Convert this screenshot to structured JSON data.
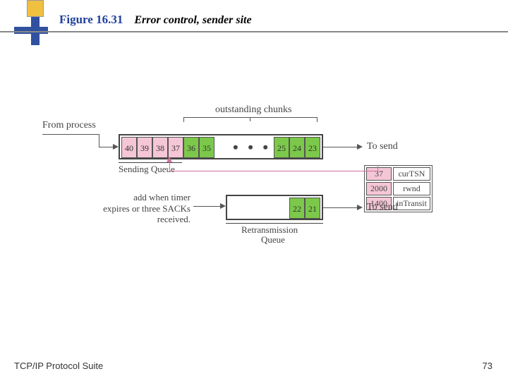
{
  "figure": {
    "number": "Figure 16.31",
    "title": "Error control, sender site"
  },
  "labels": {
    "from_process": "From process",
    "outstanding": "outstanding chunks",
    "to_send_1": "To send",
    "to_send_2": "To send",
    "sending_queue": "Sending Queue",
    "retrans_queue": "Retransmission Queue",
    "add_note_l1": "add when timer",
    "add_note_l2": "expires or three SACKs",
    "add_note_l3": "received.",
    "dots": "• • •"
  },
  "sending_queue": {
    "left": [
      "40",
      "39",
      "38",
      "37",
      "36",
      "35"
    ],
    "right": [
      "25",
      "24",
      "23"
    ]
  },
  "retrans_queue": [
    "22",
    "21"
  ],
  "state": {
    "curTSN": {
      "val": "37",
      "label": "curTSN"
    },
    "rwnd": {
      "val": "2000",
      "label": "rwnd"
    },
    "inTransit": {
      "val": "1400",
      "label": "inTransit"
    }
  },
  "footer": {
    "left": "TCP/IP Protocol Suite",
    "right": "73"
  }
}
